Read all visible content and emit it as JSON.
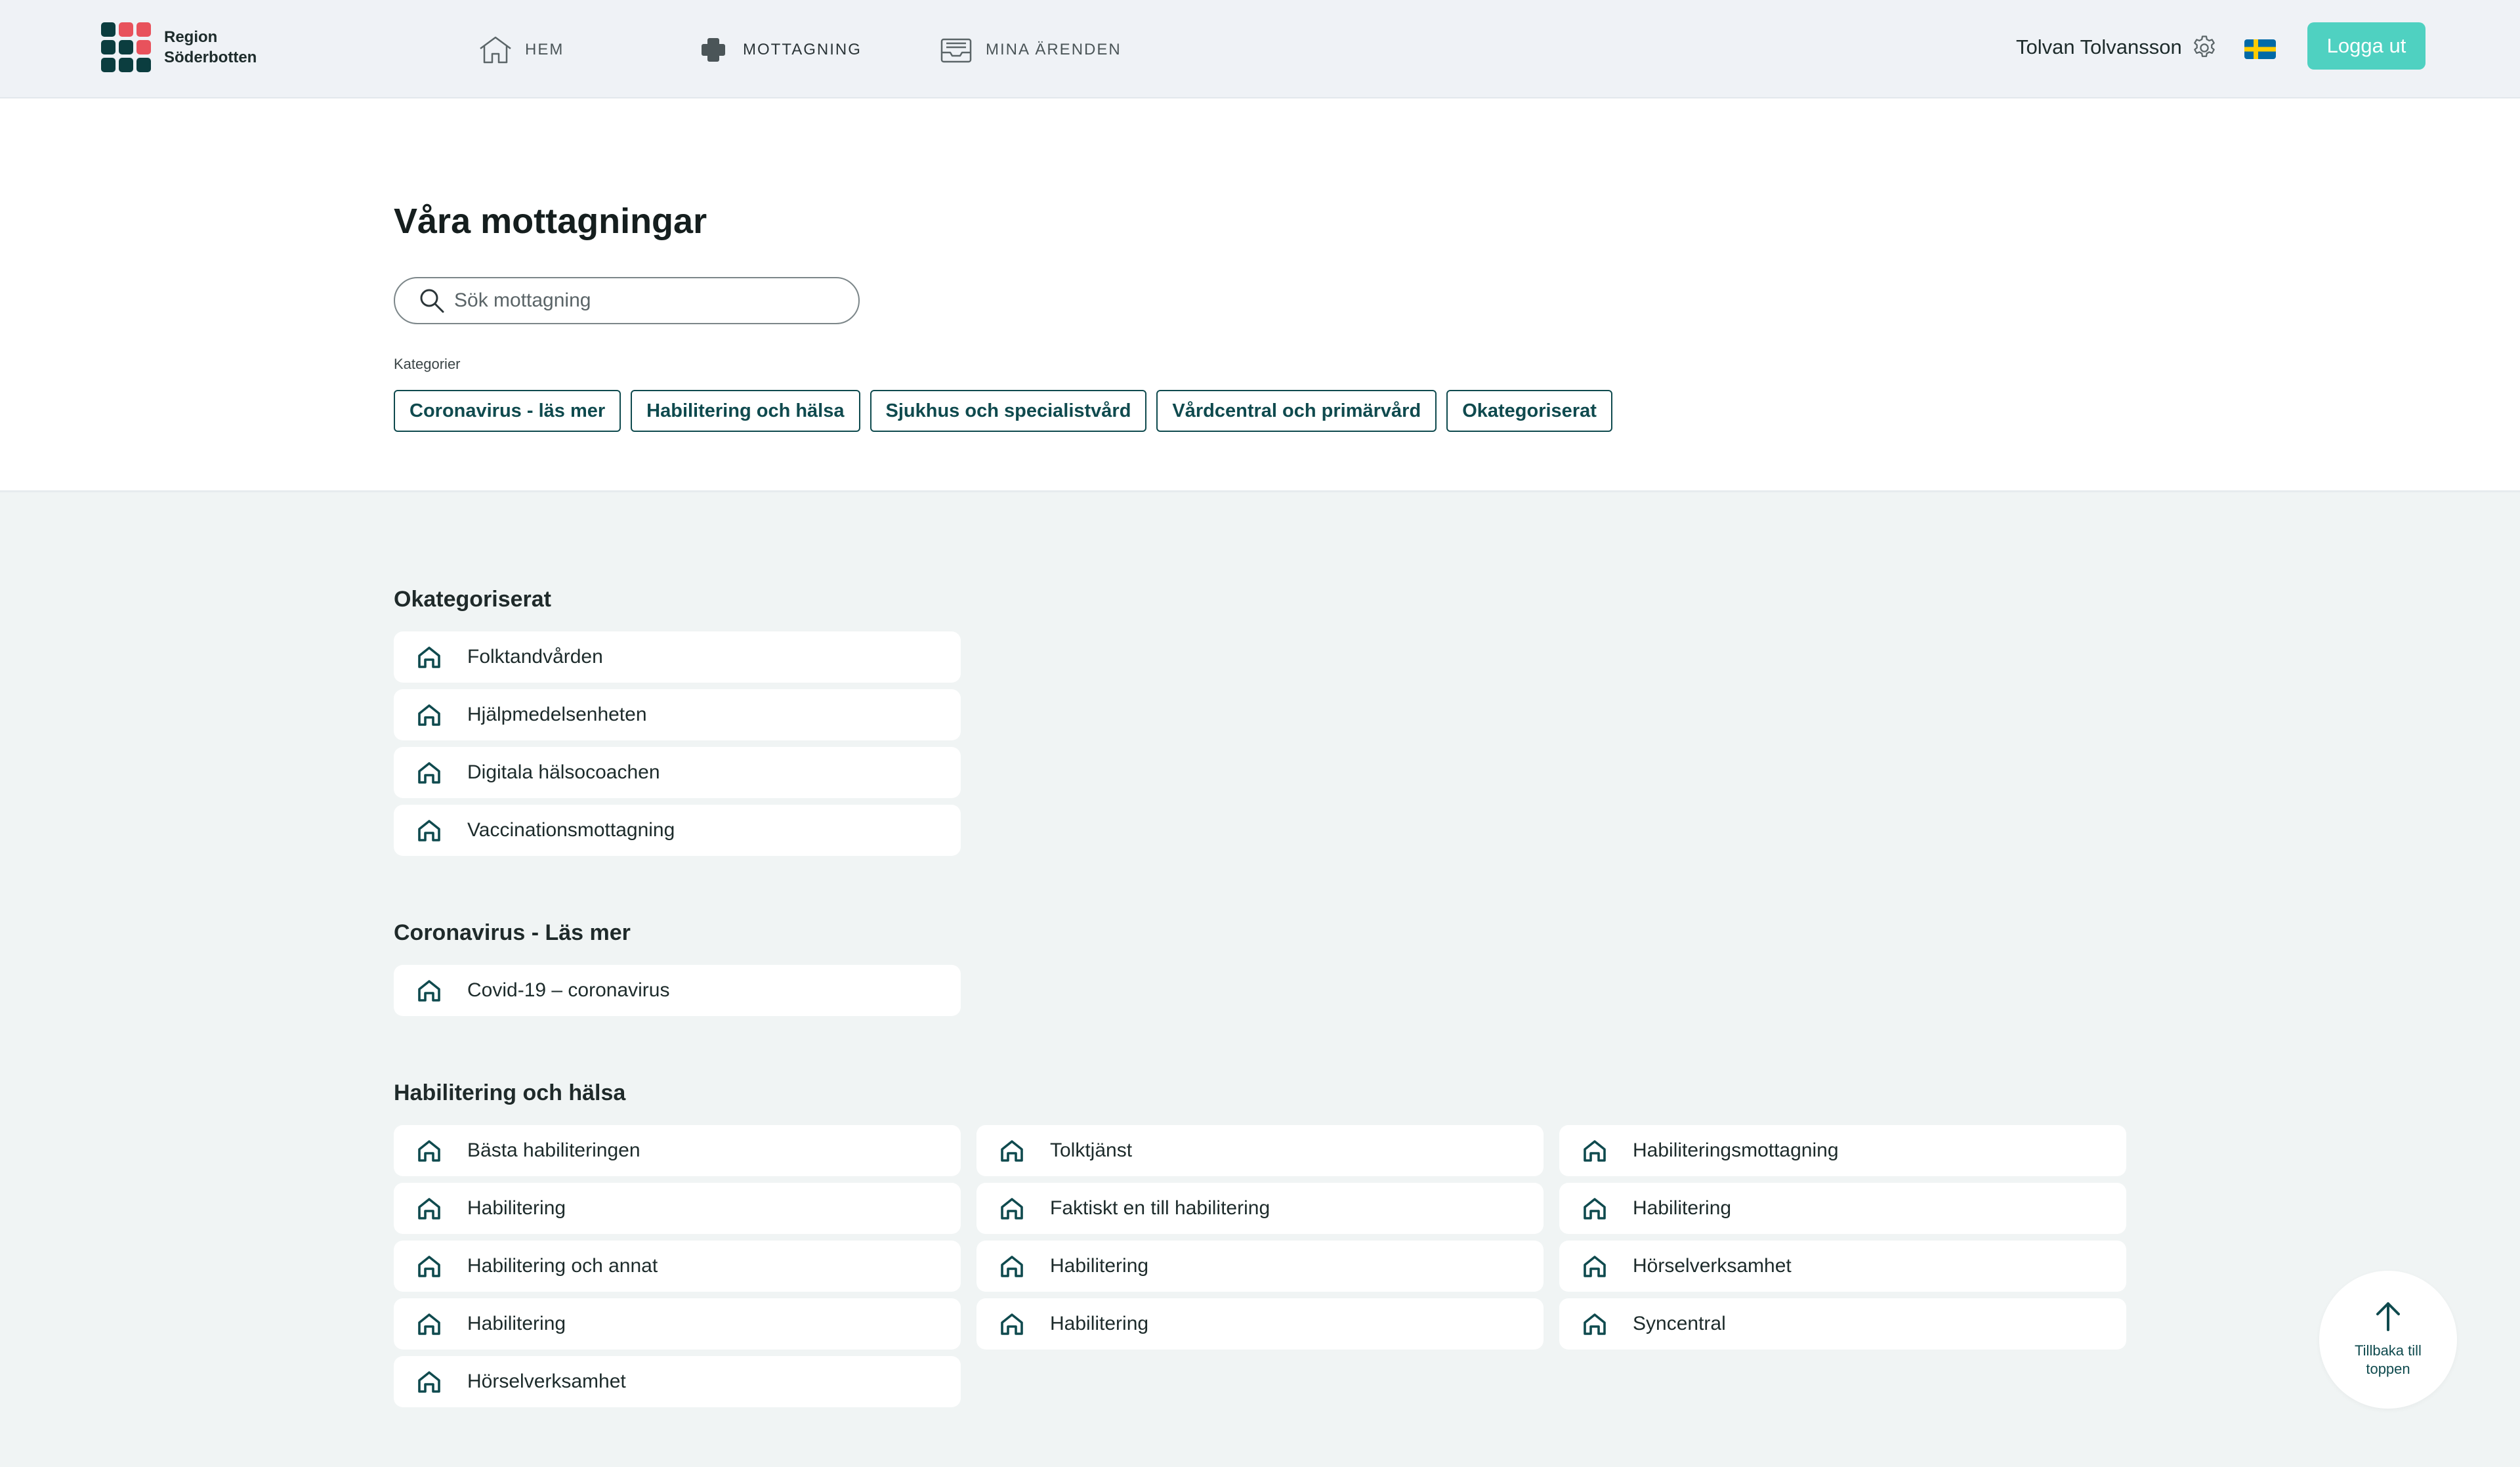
{
  "header": {
    "logo_line1": "Region",
    "logo_line2": "Söderbotten",
    "nav": [
      {
        "label": "HEM",
        "icon": "home-icon"
      },
      {
        "label": "MOTTAGNING",
        "icon": "clinic-cross-icon"
      },
      {
        "label": "MINA ÄRENDEN",
        "icon": "inbox-icon"
      }
    ],
    "user_name": "Tolvan Tolvansson",
    "logout_label": "Logga ut",
    "accent": "#4fd1c1"
  },
  "main": {
    "title": "Våra mottagningar",
    "search_placeholder": "Sök mottagning",
    "categories_label": "Kategorier",
    "categories": [
      "Coronavirus - läs mer",
      "Habilitering och hälsa",
      "Sjukhus och specialistvård",
      "Vårdcentral och primärvård",
      "Okategoriserat"
    ]
  },
  "sections": [
    {
      "title": "Okategoriserat",
      "items": [
        "Folktandvården",
        "Hjälpmedelsenheten",
        "Digitala hälsocoachen",
        "Vaccinationsmottagning"
      ]
    },
    {
      "title": "Coronavirus - Läs mer",
      "items": [
        "Covid-19 – coronavirus"
      ]
    },
    {
      "title": "Habilitering och hälsa",
      "items": [
        "Bästa habiliteringen",
        "Tolktjänst",
        "Habiliteringsmottagning",
        "Habilitering",
        "Faktiskt en till habilitering",
        "Habilitering",
        "Habilitering och annat",
        "Habilitering",
        "Hörselverksamhet",
        "Habilitering",
        "Habilitering",
        "Syncentral",
        "Hörselverksamhet"
      ]
    }
  ],
  "back_to_top": "Tillbaka till toppen"
}
